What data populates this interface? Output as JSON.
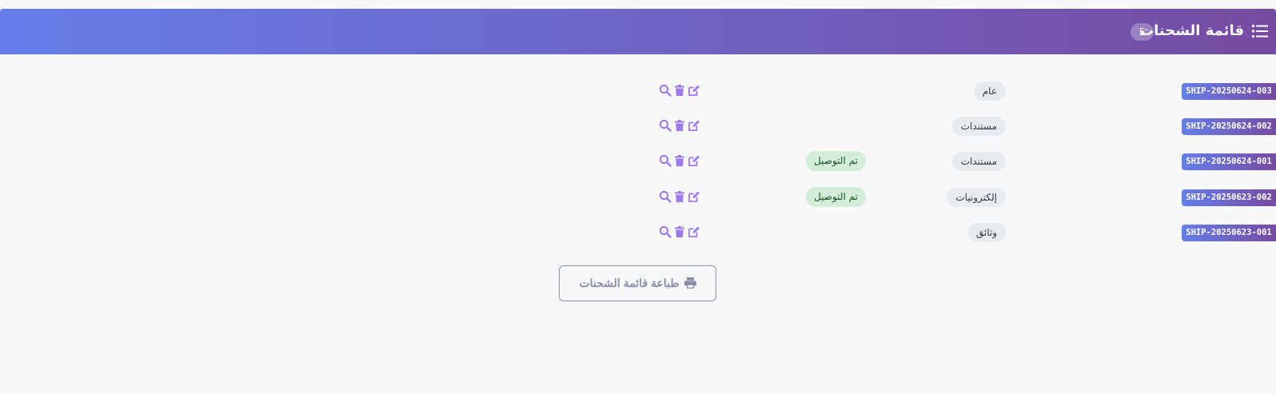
{
  "header": {
    "title": "قائمة الشحنات",
    "count": "5",
    "icon": "list-icon"
  },
  "shipments": [
    {
      "id": "SHIP-20250624-003",
      "type": "عام",
      "status": ""
    },
    {
      "id": "SHIP-20250624-002",
      "type": "مستندات",
      "status": ""
    },
    {
      "id": "SHIP-20250624-001",
      "type": "مستندات",
      "status": "تم التوصيل"
    },
    {
      "id": "SHIP-20250623-002",
      "type": "إلكترونيات",
      "status": "تم التوصيل"
    },
    {
      "id": "SHIP-20250623-001",
      "type": "وثائق",
      "status": ""
    }
  ],
  "actions": {
    "icons": [
      "search-icon",
      "trash-icon",
      "edit-icon"
    ]
  },
  "print_button": {
    "label": "طباعة قائمة الشحنات",
    "icon": "printer-icon"
  },
  "colors": {
    "gradient_start": "#667eea",
    "gradient_end": "#764ba2",
    "action_icon": "#9f7aea",
    "status_bg": "#d4edda",
    "status_text": "#155724"
  }
}
